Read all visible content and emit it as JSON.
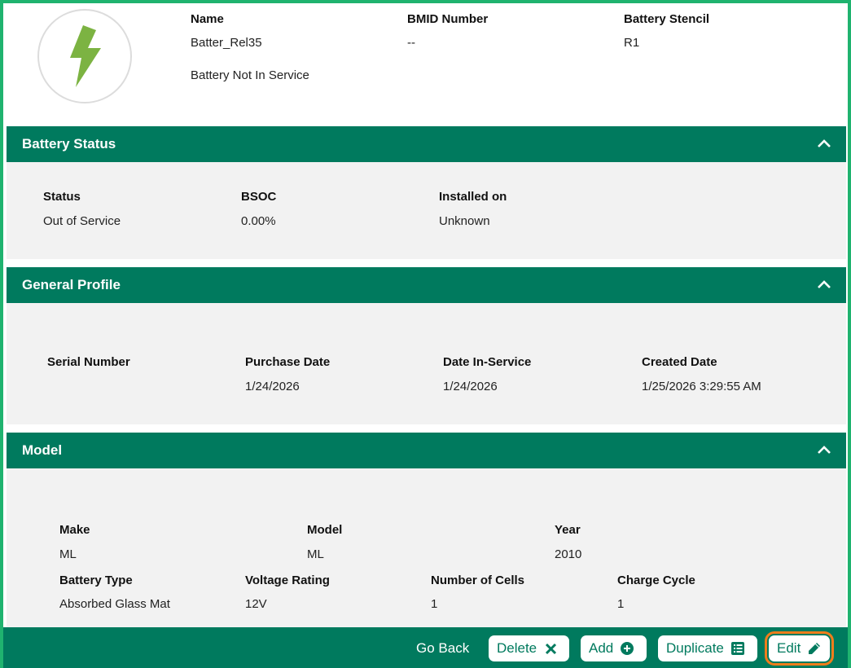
{
  "header": {
    "icon": "lightning-bolt-icon",
    "name_label": "Name",
    "name_value": "Batter_Rel35",
    "bmid_label": "BMID Number",
    "bmid_value": "--",
    "stencil_label": "Battery Stencil",
    "stencil_value": "R1",
    "service_status": "Battery Not In Service"
  },
  "battery_status": {
    "title": "Battery Status",
    "status_label": "Status",
    "status_value": "Out of Service",
    "bsoc_label": "BSOC",
    "bsoc_value": "0.00%",
    "installed_label": "Installed on",
    "installed_value": "Unknown"
  },
  "general_profile": {
    "title": "General Profile",
    "serial_label": "Serial Number",
    "serial_value": "",
    "purchase_label": "Purchase Date",
    "purchase_value": "1/24/2026",
    "inservice_label": "Date In-Service",
    "inservice_value": "1/24/2026",
    "created_label": "Created Date",
    "created_value": "1/25/2026 3:29:55 AM"
  },
  "model": {
    "title": "Model",
    "make_label": "Make",
    "make_value": "ML",
    "model_label": "Model",
    "model_value": "ML",
    "year_label": "Year",
    "year_value": "2010",
    "type_label": "Battery Type",
    "type_value": "Absorbed Glass Mat",
    "voltage_label": "Voltage Rating",
    "voltage_value": "12V",
    "cells_label": "Number of Cells",
    "cells_value": "1",
    "cycle_label": "Charge Cycle",
    "cycle_value": "1"
  },
  "footer": {
    "go_back": "Go Back",
    "delete": "Delete",
    "add": "Add",
    "duplicate": "Duplicate",
    "edit": "Edit"
  },
  "colors": {
    "brand_green": "#007a5e",
    "frame_green": "#1fb36f",
    "bolt_green": "#7cb342",
    "highlight_orange": "#f07d1b",
    "panel_gray": "#f2f2f2"
  }
}
